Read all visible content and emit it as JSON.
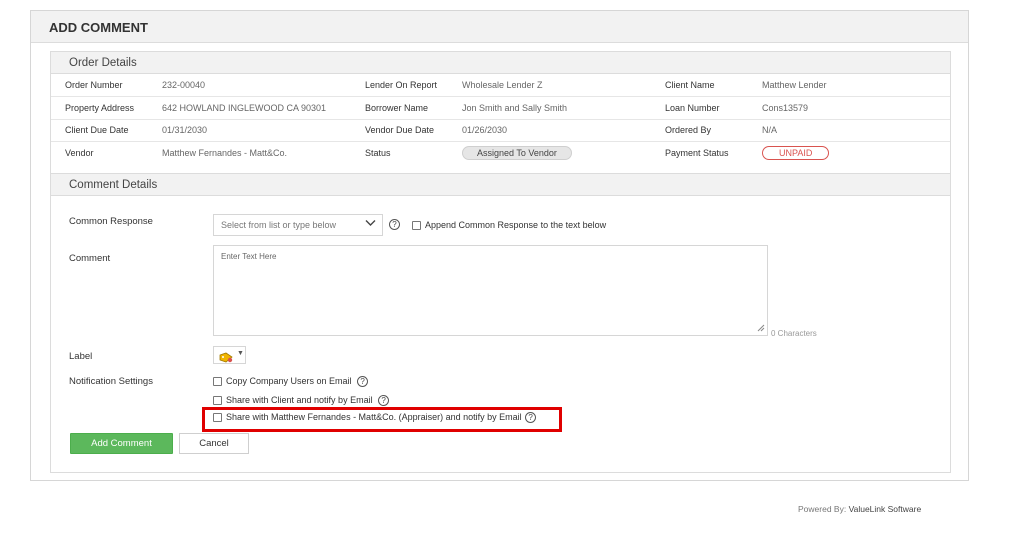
{
  "page_title": "ADD COMMENT",
  "order_details": {
    "heading": "Order Details",
    "rows": [
      [
        {
          "label": "Order Number",
          "value": "232-00040"
        },
        {
          "label": "Lender On Report",
          "value": "Wholesale Lender Z"
        },
        {
          "label": "Client Name",
          "value": "Matthew Lender"
        }
      ],
      [
        {
          "label": "Property Address",
          "value": "642 HOWLAND INGLEWOOD CA 90301"
        },
        {
          "label": "Borrower Name",
          "value": "Jon Smith and Sally Smith"
        },
        {
          "label": "Loan Number",
          "value": "Cons13579"
        }
      ],
      [
        {
          "label": "Client Due Date",
          "value": "01/31/2030"
        },
        {
          "label": "Vendor Due Date",
          "value": "01/26/2030"
        },
        {
          "label": "Ordered By",
          "value": "N/A"
        }
      ],
      [
        {
          "label": "Vendor",
          "value": "Matthew Fernandes - Matt&Co."
        },
        {
          "label": "Status",
          "value": "Assigned To Vendor"
        },
        {
          "label": "Payment Status",
          "value": "UNPAID"
        }
      ]
    ]
  },
  "comment_details": {
    "heading": "Comment Details",
    "common_response_label": "Common Response",
    "common_response_placeholder": "Select from list or type below",
    "append_label": "Append Common Response to the text below",
    "comment_label": "Comment",
    "comment_placeholder": "Enter Text Here",
    "char_count": "0 Characters",
    "label_label": "Label",
    "notification_label": "Notification Settings",
    "notify_options": [
      "Copy Company Users on Email",
      "Share with Client and notify by Email",
      "Share with Matthew Fernandes - Matt&Co. (Appraiser) and notify by Email"
    ],
    "add_button": "Add Comment",
    "cancel_button": "Cancel"
  },
  "help_glyph": "?",
  "footer": {
    "prefix": "Powered By:",
    "brand": "ValueLink Software"
  },
  "colors": {
    "primary_green": "#5cb85c",
    "unpaid_red": "#d9534f",
    "highlight_red": "#e00000"
  }
}
